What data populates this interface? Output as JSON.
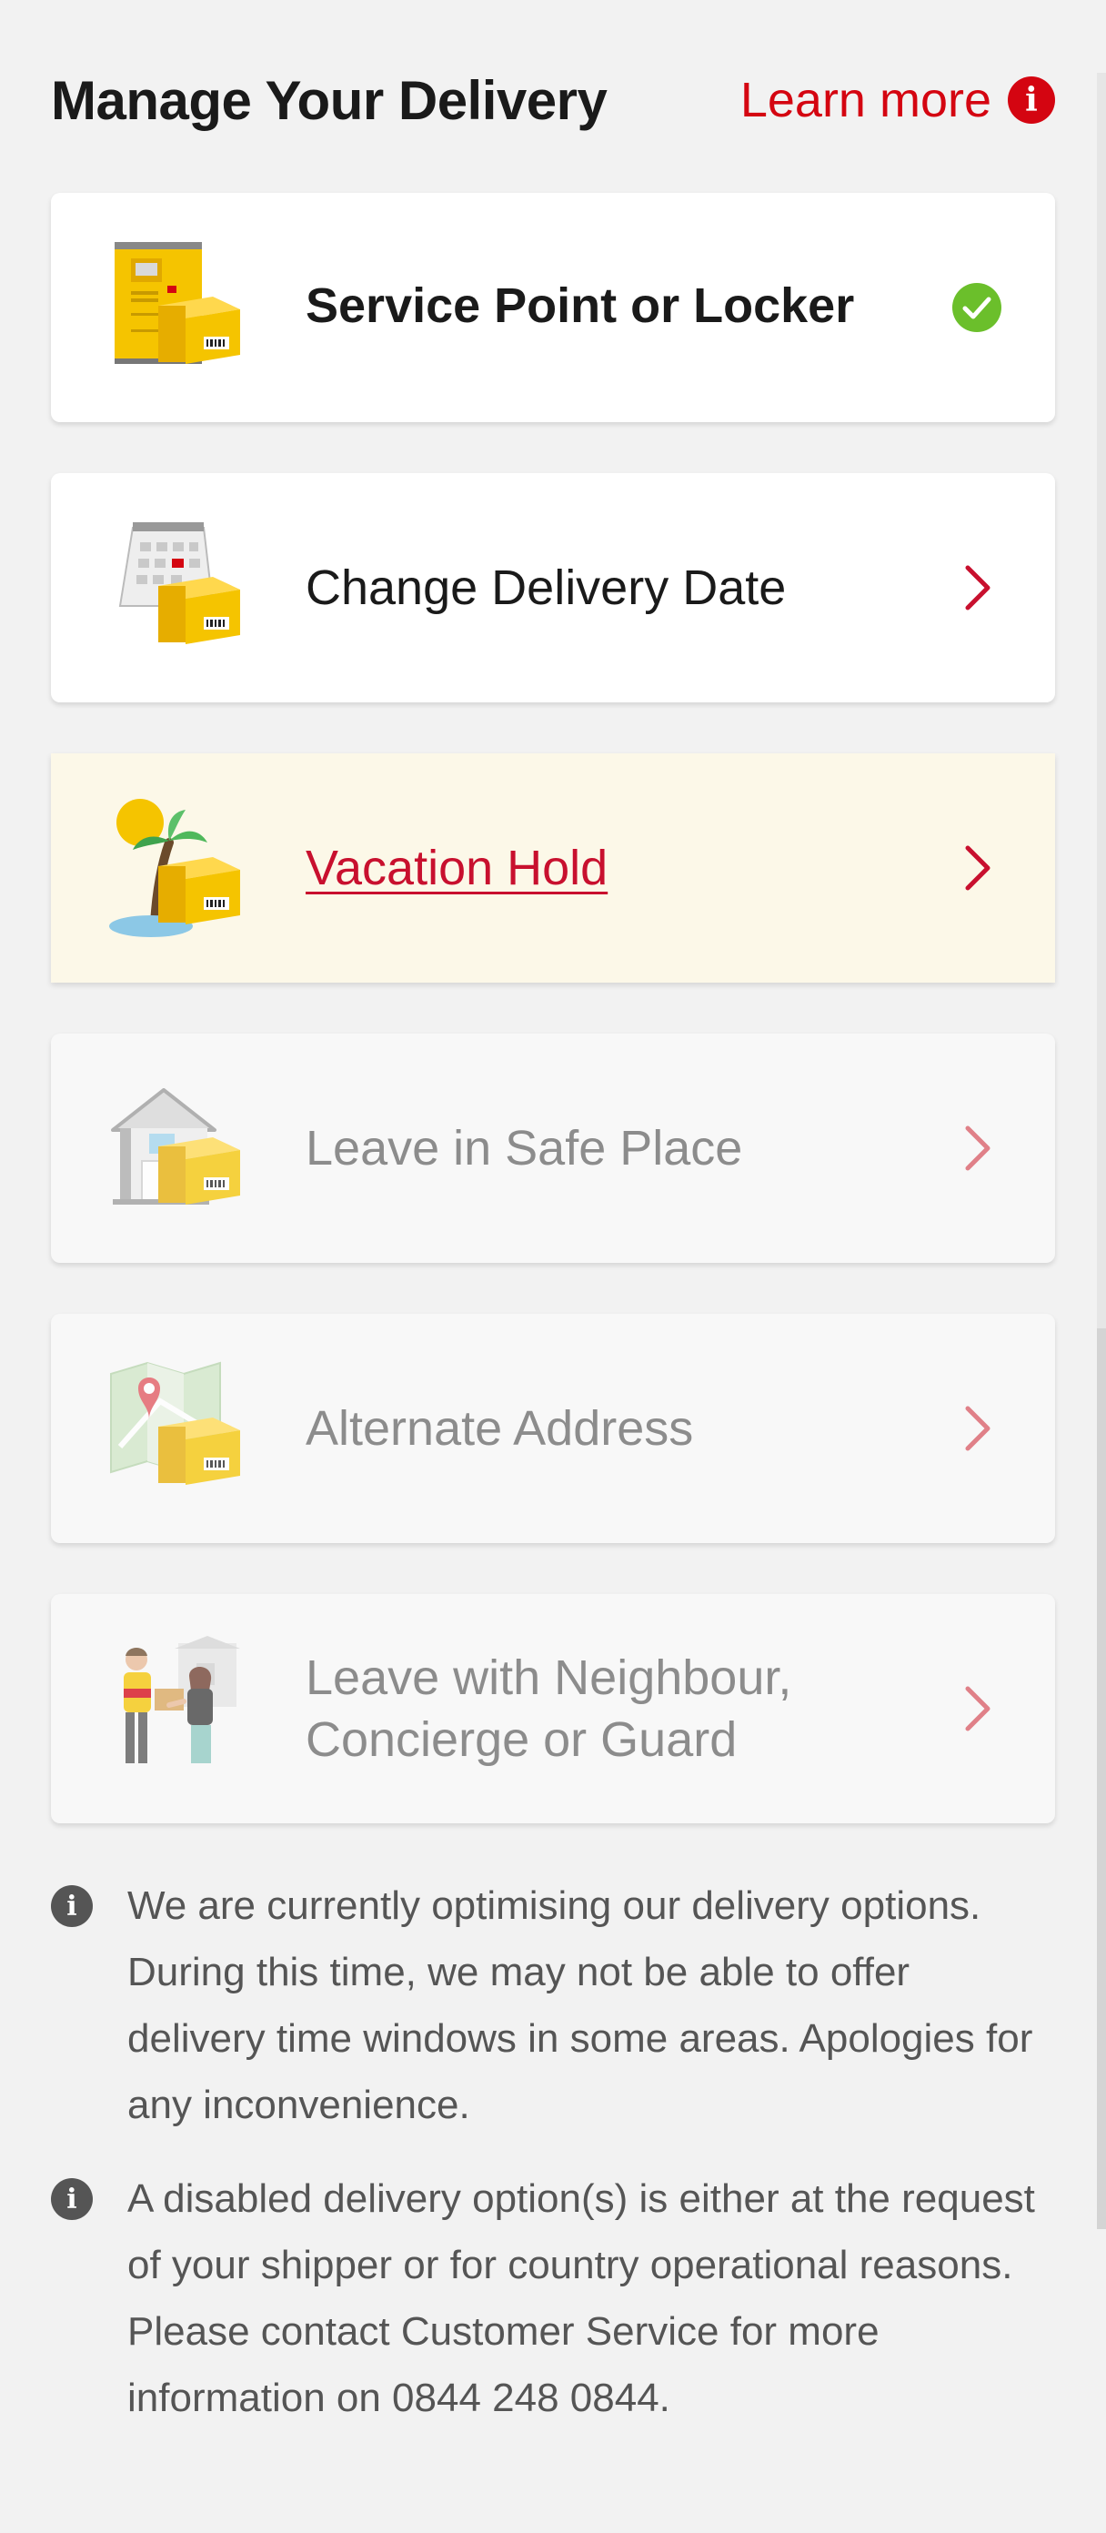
{
  "header": {
    "title": "Manage Your Delivery",
    "learn_more": "Learn more",
    "learn_more_icon": "i"
  },
  "options": [
    {
      "label": "Service Point or Locker",
      "state": "selected",
      "icon": "locker-icon",
      "trail": "check-icon"
    },
    {
      "label": "Change Delivery Date",
      "state": "enabled",
      "icon": "calendar-parcel-icon",
      "trail": "chevron-right-icon"
    },
    {
      "label": "Vacation Hold",
      "state": "hovered",
      "icon": "palm-tree-parcel-icon",
      "trail": "chevron-right-icon"
    },
    {
      "label": "Leave in Safe Place",
      "state": "disabled",
      "icon": "house-parcel-icon",
      "trail": "chevron-right-icon"
    },
    {
      "label": "Alternate Address",
      "state": "disabled",
      "icon": "map-parcel-icon",
      "trail": "chevron-right-icon"
    },
    {
      "label": "Leave with Neighbour, Concierge or Guard",
      "state": "disabled",
      "icon": "neighbour-handoff-icon",
      "trail": "chevron-right-icon"
    }
  ],
  "notes": [
    {
      "icon": "i",
      "text": "We are currently optimising our delivery options. During this time, we may not be able to offer delivery time windows in some areas. Apologies for any inconvenience."
    },
    {
      "icon": "i",
      "text": "A disabled delivery option(s) is either at the request of your shipper or for country operational reasons. Please contact Customer Service for more information on 0844 248 0844."
    }
  ],
  "colors": {
    "accent_red": "#d40511",
    "check_green": "#6bbf2b",
    "parcel_yellow": "#ffcc00",
    "hover_bg": "#fcf8e8",
    "page_bg": "#f2f2f2"
  }
}
